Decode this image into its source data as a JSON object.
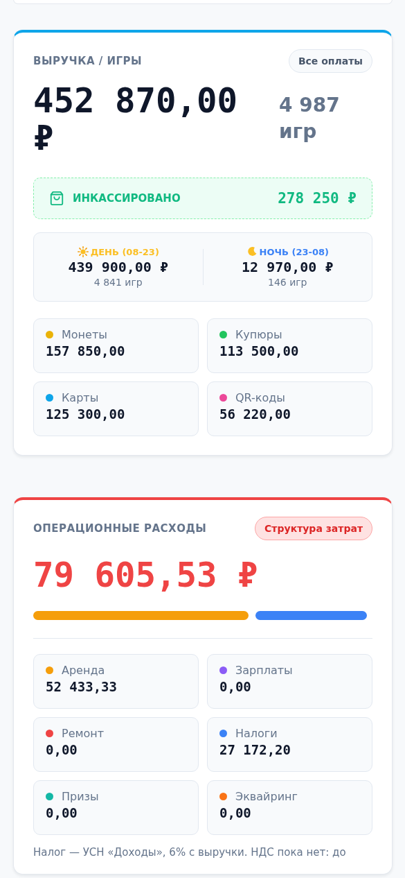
{
  "revenue": {
    "title": "ВЫРУЧКА / ИГРЫ",
    "button": "Все оплаты",
    "amount": "452 870,00 ₽",
    "games": "4 987 игр",
    "collected": {
      "label": "ИНКАССИРОВАНО",
      "amount": "278 250 ₽"
    },
    "shifts": [
      {
        "kind": "day",
        "label": "ДЕНЬ (08-23)",
        "amount": "439 900,00 ₽",
        "games": "4 841 игр"
      },
      {
        "kind": "night",
        "label": "НОЧЬ (23-08)",
        "amount": "12 970,00 ₽",
        "games": "146 игр"
      }
    ],
    "methods": [
      {
        "label": "Монеты",
        "amount": "157 850,00",
        "color": "#eab308"
      },
      {
        "label": "Купюры",
        "amount": "113 500,00",
        "color": "#22c55e"
      },
      {
        "label": "Карты",
        "amount": "125 300,00",
        "color": "#0ea5e9"
      },
      {
        "label": "QR-коды",
        "amount": "56 220,00",
        "color": "#ec4899"
      }
    ]
  },
  "expenses": {
    "title": "ОПЕРАЦИОННЫЕ РАСХОДЫ",
    "button": "Структура затрат",
    "amount": "79 605,53 ₽",
    "items": [
      {
        "label": "Аренда",
        "amount": "52 433,33",
        "color": "#f59e0b"
      },
      {
        "label": "Зарплаты",
        "amount": "0,00",
        "color": "#8b5cf6"
      },
      {
        "label": "Ремонт",
        "amount": "0,00",
        "color": "#ef4444"
      },
      {
        "label": "Налоги",
        "amount": "27 172,20",
        "color": "#3b82f6"
      },
      {
        "label": "Призы",
        "amount": "0,00",
        "color": "#14b8a6"
      },
      {
        "label": "Эквайринг",
        "amount": "0,00",
        "color": "#f97316"
      }
    ],
    "note": "Налог — УСН «Доходы», 6% с выручки. НДС пока нет: до"
  }
}
